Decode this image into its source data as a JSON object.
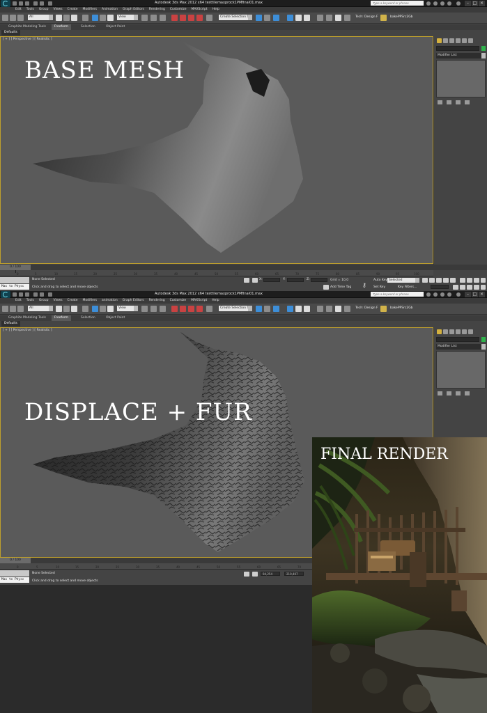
{
  "window_title": "Autodesk 3ds Max 2012 x64     testtilemaxprock1PMfinal01.max",
  "search_placeholder": "Type a keyword or phrase",
  "menu": [
    "Edit",
    "Tools",
    "Group",
    "Views",
    "Create",
    "Modifiers",
    "Animation",
    "Graph Editors",
    "Rendering",
    "Customize",
    "MAXScript",
    "Help"
  ],
  "menu2": [
    "Edit",
    "Tools",
    "Group",
    "Views",
    "Create",
    "Modifiers",
    "animation",
    "Graph Editors",
    "Rendering",
    "Customize",
    "MAXScript",
    "Help"
  ],
  "toolbar": {
    "filter_value": "All",
    "view_value": "View",
    "selection_set": "Create Selection Se",
    "tech_label": "Tech: Design F",
    "bake_label": "bakePPSrc2Gb"
  },
  "ribbon_tabs": [
    "Graphite Modeling Tools",
    "Freeform",
    "Selection",
    "Object Paint"
  ],
  "ribbon_active": "Freeform",
  "defaults_label": "Defaults",
  "viewport_label": "[ + ] [ Perspective ] [ Realistic ]",
  "command_panel": {
    "modifier_list": "Modifier List"
  },
  "top_panel": {
    "overlay_text": "BASE MESH",
    "time_slider": "0 / 100",
    "ruler_ticks": [
      "0",
      "5",
      "10",
      "15",
      "20",
      "25",
      "30",
      "35",
      "40",
      "45",
      "50",
      "55",
      "60",
      "65",
      "70",
      "75",
      "80",
      "85",
      "90",
      "95",
      "100"
    ],
    "status_selection": "None Selected",
    "status_prompt": "Click and drag to select and move objects",
    "listener": "Max to Physc",
    "grid": "Grid = 10,0",
    "auto_key": "Auto Key",
    "auto_key_value": "Selected",
    "set_key": "Set Key",
    "key_filters": "Key Filters...",
    "add_time_tag": "Add Time Tag",
    "coord_x": "X:",
    "coord_y": "Y:",
    "coord_z": "Z:"
  },
  "bottom_panel": {
    "overlay_text": "DISPLACE + FUR",
    "time_slider": "0 / 100",
    "ruler_ticks": [
      "0",
      "5",
      "10",
      "15",
      "20",
      "25",
      "30",
      "35",
      "40",
      "45",
      "50",
      "55",
      "60",
      "65",
      "70"
    ],
    "status_selection": "None Selected",
    "status_prompt": "Click and drag to select and move objects",
    "listener": "Max to Physc",
    "coord_x_value": "94,254",
    "coord_y_value": "210,407"
  },
  "final_render": {
    "label": "FINAL RENDER"
  },
  "colors": {
    "viewport_border": "#bfa02c",
    "viewport_bg": "#5a5a5a",
    "object_color": "#2fb34c"
  }
}
